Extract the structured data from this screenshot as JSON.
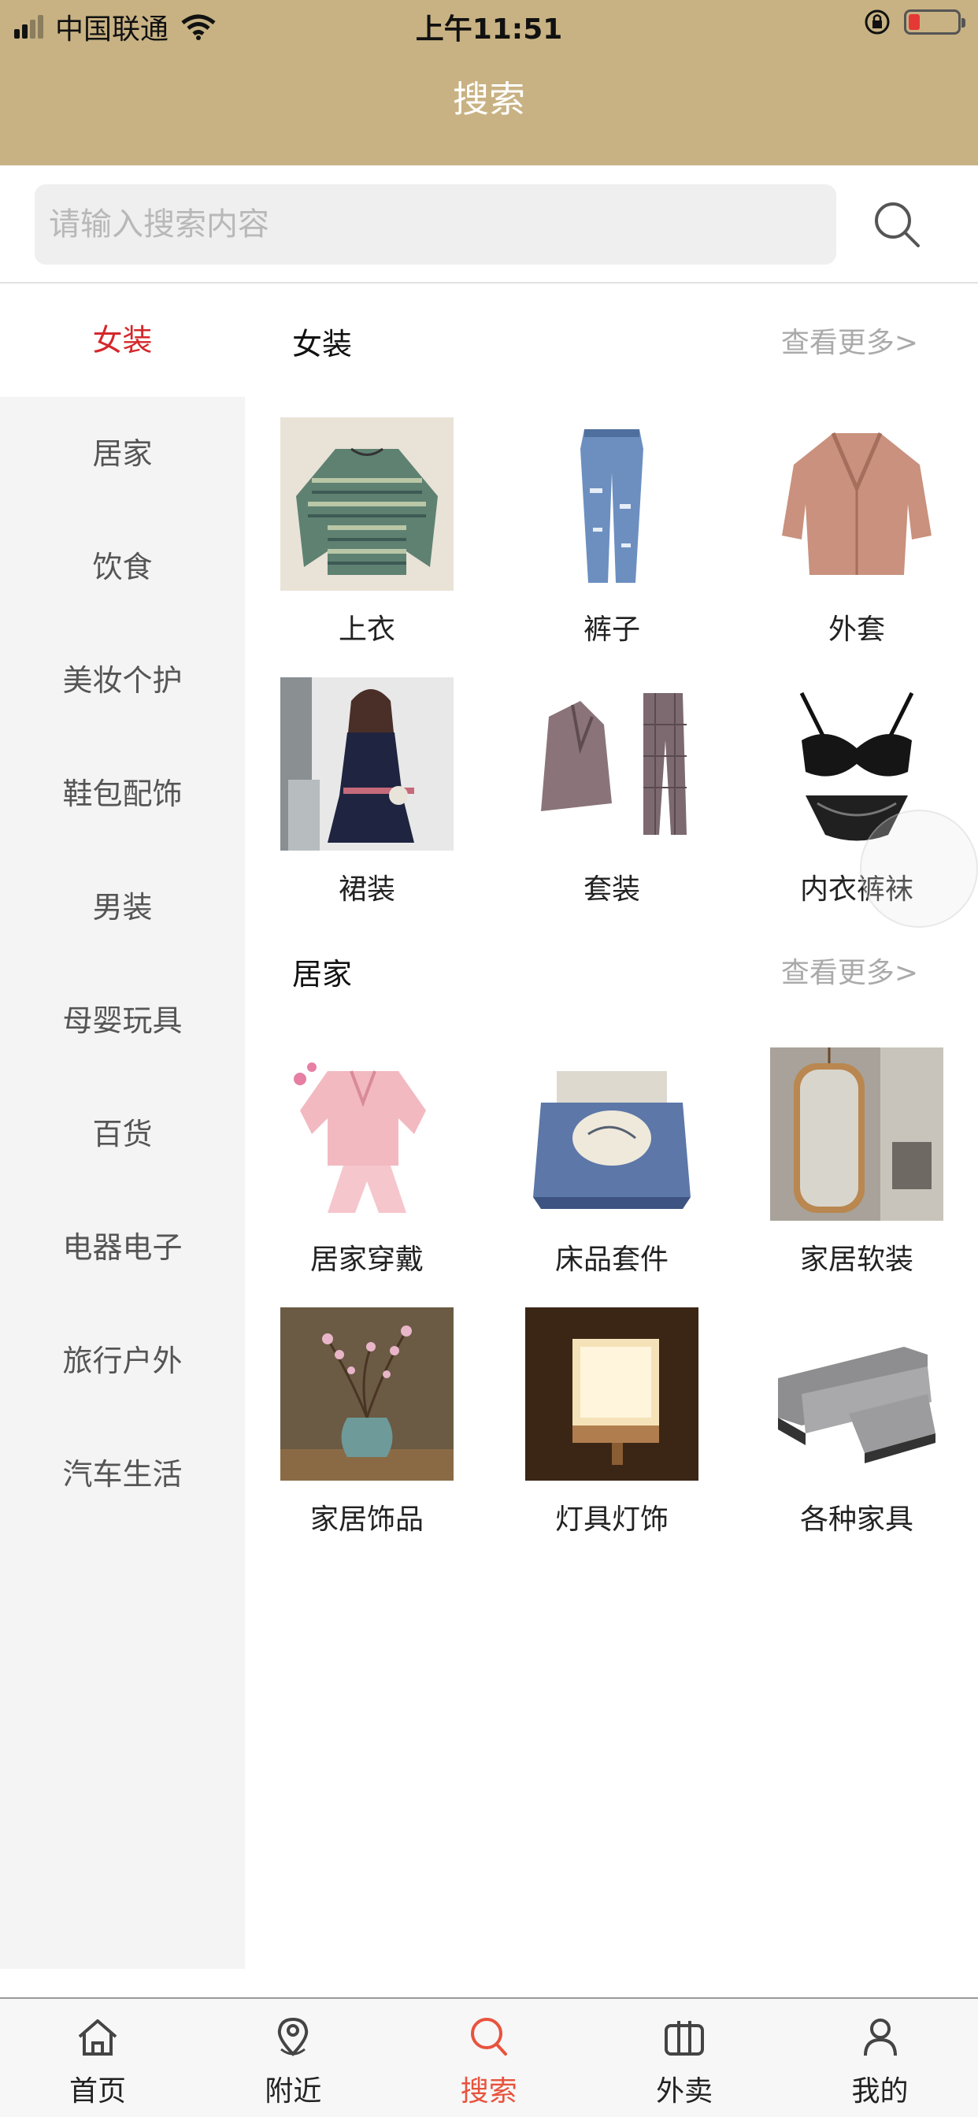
{
  "status_bar": {
    "carrier": "中国联通",
    "time": "上午11:51"
  },
  "header": {
    "title": "搜索"
  },
  "search": {
    "placeholder": "请输入搜索内容",
    "value": ""
  },
  "sidebar": {
    "items": [
      {
        "label": "女装",
        "active": true
      },
      {
        "label": "居家",
        "active": false
      },
      {
        "label": "饮食",
        "active": false
      },
      {
        "label": "美妆个护",
        "active": false
      },
      {
        "label": "鞋包配饰",
        "active": false
      },
      {
        "label": "男装",
        "active": false
      },
      {
        "label": "母婴玩具",
        "active": false
      },
      {
        "label": "百货",
        "active": false
      },
      {
        "label": "电器电子",
        "active": false
      },
      {
        "label": "旅行户外",
        "active": false
      },
      {
        "label": "汽车生活",
        "active": false
      }
    ]
  },
  "sections": [
    {
      "title": "女装",
      "more": "查看更多>",
      "items": [
        {
          "label": "上衣",
          "icon": "sweater-image"
        },
        {
          "label": "裤子",
          "icon": "jeans-image"
        },
        {
          "label": "外套",
          "icon": "coat-image"
        },
        {
          "label": "裙装",
          "icon": "dress-image"
        },
        {
          "label": "套装",
          "icon": "suit-image"
        },
        {
          "label": "内衣裤袜",
          "icon": "lingerie-image"
        }
      ]
    },
    {
      "title": "居家",
      "more": "查看更多>",
      "items": [
        {
          "label": "居家穿戴",
          "icon": "pajamas-image"
        },
        {
          "label": "床品套件",
          "icon": "bedding-image"
        },
        {
          "label": "家居软装",
          "icon": "mirror-image"
        },
        {
          "label": "家居饰品",
          "icon": "vase-image"
        },
        {
          "label": "灯具灯饰",
          "icon": "lamp-image"
        },
        {
          "label": "各种家具",
          "icon": "sofa-image"
        }
      ]
    }
  ],
  "tabbar": {
    "items": [
      {
        "label": "首页",
        "icon": "home-icon",
        "active": false
      },
      {
        "label": "附近",
        "icon": "location-icon",
        "active": false
      },
      {
        "label": "搜索",
        "icon": "search-icon",
        "active": true
      },
      {
        "label": "外卖",
        "icon": "takeout-icon",
        "active": false
      },
      {
        "label": "我的",
        "icon": "user-icon",
        "active": false
      }
    ]
  },
  "colors": {
    "header_bg": "#c8b283",
    "active_category": "#d4282b",
    "active_tab": "#e8533d"
  }
}
